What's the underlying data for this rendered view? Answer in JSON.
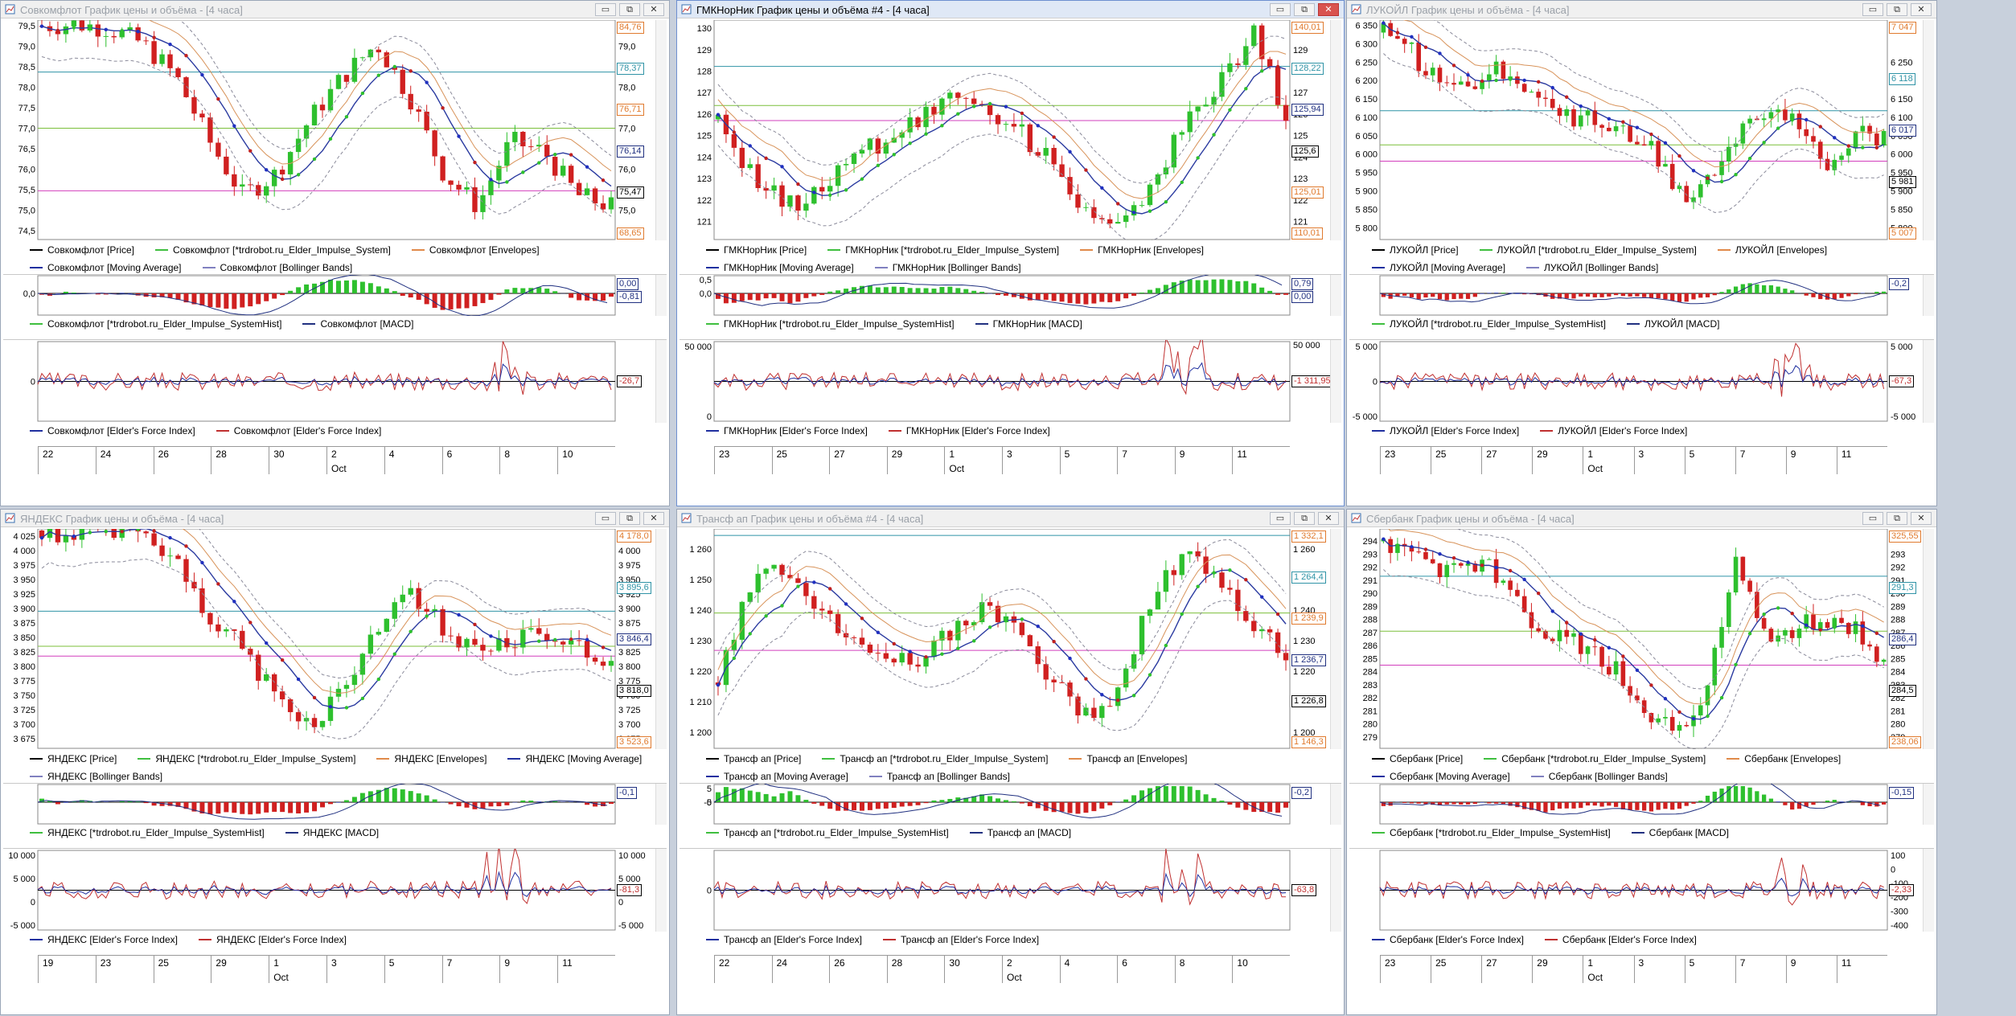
{
  "buttons": {
    "min": "▭",
    "max": "⧉",
    "close": "✕"
  },
  "windows": [
    {
      "id": "w1",
      "title": "Совкомфлот График цены и объёма - [4 часа]",
      "active": false,
      "y": [
        74.3,
        79.6
      ],
      "y_ticks": [
        "79,5",
        "79,0",
        "78,5",
        "78,0",
        "77,5",
        "77,0",
        "76,5",
        "76,0",
        "75,5",
        "75,0",
        "74,5"
      ],
      "r_ticks": [
        "79,5",
        "79,0",
        "78,5",
        "78,0",
        "77,5",
        "77,0",
        "76,5",
        "76,0",
        "75,5",
        "75,0",
        "74,5"
      ],
      "hlines": [
        {
          "v": 78.37,
          "c": "#2f93a6"
        },
        {
          "v": 77.0,
          "c": "#7bbf3a"
        },
        {
          "v": 75.47,
          "c": "#d23fbd"
        }
      ],
      "tags": [
        {
          "t": "84,76",
          "c": "#e07a2e"
        },
        {
          "t": "78,37",
          "c": "#2f93a6"
        },
        {
          "t": "76,71",
          "c": "#e07a2e"
        },
        {
          "t": "76,14",
          "c": "#203080"
        },
        {
          "t": "75,47",
          "c": "#000"
        },
        {
          "t": "68,65",
          "c": "#e07a2e"
        }
      ],
      "legend1": [
        [
          "#000",
          "Совкомфлот [Price]"
        ],
        [
          "#3fbf3f",
          "Совкомфлот [*trdrobot.ru_Elder_Impulse_System]"
        ],
        [
          "#e08a4a",
          "Совкомфлот [Envelopes]"
        ],
        [
          "#2030a0",
          "Совкомфлот [Moving Average]"
        ],
        [
          "#8080c0",
          "Совкомфлот [Bollinger Bands]"
        ]
      ],
      "h_ticks": [
        "0,0"
      ],
      "h_tags": [
        "0,00",
        "-0,81"
      ],
      "legend2": [
        [
          "#3fbf3f",
          "Совкомфлот [*trdrobot.ru_Elder_Impulse_SystemHist]"
        ],
        [
          "#203080",
          "Совкомфлот [MACD]"
        ]
      ],
      "f_ticks": [
        "0"
      ],
      "f_rticks": [],
      "f_tag": "-26,7",
      "legend3": [
        [
          "#2030a0",
          "Совкомфлот [Elder's Force Index]"
        ],
        [
          "#c03030",
          "Совкомфлот [Elder's Force Index]"
        ]
      ],
      "dates": [
        "22",
        "24",
        "26",
        "28",
        "30",
        "2",
        "4",
        "6",
        "8",
        "10"
      ],
      "month": "Oct",
      "mon_idx": 5
    },
    {
      "id": "w2",
      "title": "ГМКНорНик График цены и объёма #4 - [4 часа]",
      "active": true,
      "y": [
        120.2,
        130.3
      ],
      "y_ticks": [
        "130",
        "129",
        "128",
        "127",
        "126",
        "125",
        "124",
        "123",
        "122",
        "121"
      ],
      "r_ticks": [
        "129",
        "128",
        "127",
        "126",
        "125",
        "124",
        "123",
        "122",
        "121"
      ],
      "hlines": [
        {
          "v": 128.22,
          "c": "#2f93a6"
        },
        {
          "v": 126.4,
          "c": "#7bbf3a"
        },
        {
          "v": 125.7,
          "c": "#d23fbd"
        }
      ],
      "tags": [
        {
          "t": "140,01",
          "c": "#e07a2e"
        },
        {
          "t": "128,22",
          "c": "#2f93a6"
        },
        {
          "t": "125,94",
          "c": "#203080"
        },
        {
          "t": "125,6",
          "c": "#000"
        },
        {
          "t": "125,01",
          "c": "#e07a2e"
        },
        {
          "t": "110,01",
          "c": "#e07a2e"
        }
      ],
      "legend1": [
        [
          "#000",
          "ГМКНорНик [Price]"
        ],
        [
          "#3fbf3f",
          "ГМКНорНик [*trdrobot.ru_Elder_Impulse_System]"
        ],
        [
          "#e08a4a",
          "ГМКНорНик [Envelopes]"
        ],
        [
          "#2030a0",
          "ГМКНорНик [Moving Average]"
        ],
        [
          "#8080c0",
          "ГМКНорНик [Bollinger Bands]"
        ]
      ],
      "h_ticks": [
        "0,5",
        "0,0"
      ],
      "h_tags": [
        "0,79",
        "0,00"
      ],
      "legend2": [
        [
          "#3fbf3f",
          "ГМКНорНик [*trdrobot.ru_Elder_Impulse_SystemHist]"
        ],
        [
          "#203080",
          "ГМКНорНик [MACD]"
        ]
      ],
      "f_ticks": [
        "50 000",
        "0"
      ],
      "f_rticks": [
        "50 000"
      ],
      "f_tag": "-1 311,95",
      "legend3": [
        [
          "#2030a0",
          "ГМКНорНик [Elder's Force Index]"
        ],
        [
          "#c03030",
          "ГМКНорНик [Elder's Force Index]"
        ]
      ],
      "dates": [
        "23",
        "25",
        "27",
        "29",
        "1",
        "3",
        "5",
        "7",
        "9",
        "11"
      ],
      "month": "Oct",
      "mon_idx": 4
    },
    {
      "id": "w3",
      "title": "ЛУКОЙЛ График цены и объёма - [4 часа]",
      "active": false,
      "y": [
        5770,
        6360
      ],
      "y_ticks": [
        "6 350",
        "6 300",
        "6 250",
        "6 200",
        "6 150",
        "6 100",
        "6 050",
        "6 000",
        "5 950",
        "5 900",
        "5 850",
        "5 800"
      ],
      "r_ticks": [
        "6 250",
        "6 200",
        "6 150",
        "6 100",
        "6 050",
        "6 000",
        "5 950",
        "5 900",
        "5 850",
        "5 800"
      ],
      "hlines": [
        {
          "v": 6118,
          "c": "#2f93a6"
        },
        {
          "v": 6025,
          "c": "#7bbf3a"
        },
        {
          "v": 5981,
          "c": "#d23fbd"
        }
      ],
      "tags": [
        {
          "t": "7 047",
          "c": "#e07a2e"
        },
        {
          "t": "6 118",
          "c": "#2f93a6"
        },
        {
          "t": "6 017",
          "c": "#203080"
        },
        {
          "t": "5 981",
          "c": "#000"
        },
        {
          "t": "5 007",
          "c": "#e07a2e"
        }
      ],
      "legend1": [
        [
          "#000",
          "ЛУКОЙЛ [Price]"
        ],
        [
          "#3fbf3f",
          "ЛУКОЙЛ [*trdrobot.ru_Elder_Impulse_System]"
        ],
        [
          "#e08a4a",
          "ЛУКОЙЛ [Envelopes]"
        ],
        [
          "#2030a0",
          "ЛУКОЙЛ [Moving Average]"
        ],
        [
          "#8080c0",
          "ЛУКОЙЛ [Bollinger Bands]"
        ]
      ],
      "h_ticks": [],
      "h_tags": [
        "-0,2"
      ],
      "legend2": [
        [
          "#3fbf3f",
          "ЛУКОЙЛ [*trdrobot.ru_Elder_Impulse_SystemHist]"
        ],
        [
          "#203080",
          "ЛУКОЙЛ [MACD]"
        ]
      ],
      "f_ticks": [
        "5 000",
        "0",
        "-5 000"
      ],
      "f_rticks": [
        "5 000",
        "0",
        "-5 000"
      ],
      "f_tag": "-67,3",
      "legend3": [
        [
          "#2030a0",
          "ЛУКОЙЛ [Elder's Force Index]"
        ],
        [
          "#c03030",
          "ЛУКОЙЛ [Elder's Force Index]"
        ]
      ],
      "dates": [
        "23",
        "25",
        "27",
        "29",
        "1",
        "3",
        "5",
        "7",
        "9",
        "11"
      ],
      "month": "Oct",
      "mon_idx": 4
    },
    {
      "id": "w4",
      "title": "ЯНДЕКС График цены и объёма - [4 часа]",
      "active": false,
      "y": [
        3660,
        4035
      ],
      "y_ticks": [
        "4 025",
        "4 000",
        "3 975",
        "3 950",
        "3 925",
        "3 900",
        "3 875",
        "3 850",
        "3 825",
        "3 800",
        "3 775",
        "3 750",
        "3 725",
        "3 700",
        "3 675"
      ],
      "r_ticks": [
        "4 000",
        "3 975",
        "3 950",
        "3 925",
        "3 900",
        "3 875",
        "3 850",
        "3 825",
        "3 800",
        "3 775",
        "3 750",
        "3 725",
        "3 700",
        "3 675"
      ],
      "hlines": [
        {
          "v": 3895.6,
          "c": "#2f93a6"
        },
        {
          "v": 3835,
          "c": "#7bbf3a"
        },
        {
          "v": 3818,
          "c": "#d23fbd"
        }
      ],
      "tags": [
        {
          "t": "4 178,0",
          "c": "#e07a2e"
        },
        {
          "t": "3 895,6",
          "c": "#2f93a6"
        },
        {
          "t": "3 846,4",
          "c": "#203080"
        },
        {
          "t": "3 818,0",
          "c": "#000"
        },
        {
          "t": "3 523,6",
          "c": "#e07a2e"
        }
      ],
      "legend1": [
        [
          "#000",
          "ЯНДЕКС [Price]"
        ],
        [
          "#3fbf3f",
          "ЯНДЕКС [*trdrobot.ru_Elder_Impulse_System]"
        ],
        [
          "#e08a4a",
          "ЯНДЕКС [Envelopes]"
        ],
        [
          "#2030a0",
          "ЯНДЕКС [Moving Average]"
        ],
        [
          "#8080c0",
          "ЯНДЕКС [Bollinger Bands]"
        ]
      ],
      "h_ticks": [],
      "h_tags": [
        "-0,1"
      ],
      "legend2": [
        [
          "#3fbf3f",
          "ЯНДЕКС [*trdrobot.ru_Elder_Impulse_SystemHist]"
        ],
        [
          "#203080",
          "ЯНДЕКС [MACD]"
        ]
      ],
      "f_ticks": [
        "10 000",
        "5 000",
        "0",
        "-5 000"
      ],
      "f_rticks": [
        "10 000",
        "5 000",
        "0",
        "-5 000"
      ],
      "f_tag": "-81,3",
      "legend3": [
        [
          "#2030a0",
          "ЯНДЕКС [Elder's Force Index]"
        ],
        [
          "#c03030",
          "ЯНДЕКС [Elder's Force Index]"
        ]
      ],
      "dates": [
        "19",
        "23",
        "25",
        "29",
        "1",
        "3",
        "5",
        "7",
        "9",
        "11"
      ],
      "month": "Oct",
      "mon_idx": 4
    },
    {
      "id": "w5",
      "title": "Трансф ап График цены и объёма #4 - [4 часа]",
      "active": false,
      "y": [
        1195,
        1266
      ],
      "y_ticks": [
        "1 260",
        "1 250",
        "1 240",
        "1 230",
        "1 220",
        "1 210",
        "1 200"
      ],
      "r_ticks": [
        "1 260",
        "1 250",
        "1 240",
        "1 230",
        "1 220",
        "1 210",
        "1 200"
      ],
      "hlines": [
        {
          "v": 1264.4,
          "c": "#2f93a6"
        },
        {
          "v": 1239,
          "c": "#7bbf3a"
        },
        {
          "v": 1226.8,
          "c": "#d23fbd"
        }
      ],
      "tags": [
        {
          "t": "1 332,1",
          "c": "#e07a2e"
        },
        {
          "t": "1 264,4",
          "c": "#2f93a6"
        },
        {
          "t": "1 239,9",
          "c": "#e07a2e"
        },
        {
          "t": "1 236,7",
          "c": "#203080"
        },
        {
          "t": "1 226,8",
          "c": "#000"
        },
        {
          "t": "1 146,3",
          "c": "#e07a2e"
        }
      ],
      "legend1": [
        [
          "#000",
          "Трансф ап [Price]"
        ],
        [
          "#3fbf3f",
          "Трансф ап [*trdrobot.ru_Elder_Impulse_System]"
        ],
        [
          "#e08a4a",
          "Трансф ап [Envelopes]"
        ],
        [
          "#2030a0",
          "Трансф ап [Moving Average]"
        ],
        [
          "#8080c0",
          "Трансф ап [Bollinger Bands]"
        ]
      ],
      "h_ticks": [
        "5",
        "0",
        "-5"
      ],
      "h_tags": [
        "-0,2"
      ],
      "legend2": [
        [
          "#3fbf3f",
          "Трансф ап [*trdrobot.ru_Elder_Impulse_SystemHist]"
        ],
        [
          "#203080",
          "Трансф ап [MACD]"
        ]
      ],
      "f_ticks": [
        "0"
      ],
      "f_rticks": [],
      "f_tag": "-63,8",
      "legend3": [
        [
          "#2030a0",
          "Трансф ап [Elder's Force Index]"
        ],
        [
          "#c03030",
          "Трансф ап [Elder's Force Index]"
        ]
      ],
      "dates": [
        "22",
        "24",
        "26",
        "28",
        "30",
        "2",
        "4",
        "6",
        "8",
        "10"
      ],
      "month": "Oct",
      "mon_idx": 5
    },
    {
      "id": "w6",
      "title": "Сбербанк График цены и объёма - [4 часа]",
      "active": false,
      "y": [
        278.2,
        294.8
      ],
      "y_ticks": [
        "294",
        "293",
        "292",
        "291",
        "290",
        "289",
        "288",
        "287",
        "286",
        "285",
        "284",
        "283",
        "282",
        "281",
        "280",
        "279"
      ],
      "r_ticks": [
        "293",
        "292",
        "291",
        "290",
        "289",
        "288",
        "287",
        "286",
        "285",
        "284",
        "283",
        "282",
        "281",
        "280",
        "279"
      ],
      "hlines": [
        {
          "v": 291.3,
          "c": "#2f93a6"
        },
        {
          "v": 287.1,
          "c": "#7bbf3a"
        },
        {
          "v": 284.5,
          "c": "#d23fbd"
        }
      ],
      "tags": [
        {
          "t": "325,55",
          "c": "#e07a2e"
        },
        {
          "t": "291,3",
          "c": "#2f93a6"
        },
        {
          "t": "286,4",
          "c": "#203080"
        },
        {
          "t": "284,5",
          "c": "#000"
        },
        {
          "t": "238,06",
          "c": "#e07a2e"
        }
      ],
      "legend1": [
        [
          "#000",
          "Сбербанк [Price]"
        ],
        [
          "#3fbf3f",
          "Сбербанк [*trdrobot.ru_Elder_Impulse_System]"
        ],
        [
          "#e08a4a",
          "Сбербанк [Envelopes]"
        ],
        [
          "#2030a0",
          "Сбербанк [Moving Average]"
        ],
        [
          "#8080c0",
          "Сбербанк [Bollinger Bands]"
        ]
      ],
      "h_ticks": [],
      "h_tags": [
        "-0,15"
      ],
      "legend2": [
        [
          "#3fbf3f",
          "Сбербанк [*trdrobot.ru_Elder_Impulse_SystemHist]"
        ],
        [
          "#203080",
          "Сбербанк [MACD]"
        ]
      ],
      "f_ticks": [],
      "f_rticks": [
        "100",
        "0",
        "-100",
        "-200",
        "-300",
        "-400"
      ],
      "f_tag": "-2,33",
      "legend3": [
        [
          "#2030a0",
          "Сбербанк [Elder's Force Index]"
        ],
        [
          "#c03030",
          "Сбербанк [Elder's Force Index]"
        ]
      ],
      "dates": [
        "23",
        "25",
        "27",
        "29",
        "1",
        "3",
        "5",
        "7",
        "9",
        "11"
      ],
      "month": "Oct",
      "mon_idx": 4
    }
  ]
}
